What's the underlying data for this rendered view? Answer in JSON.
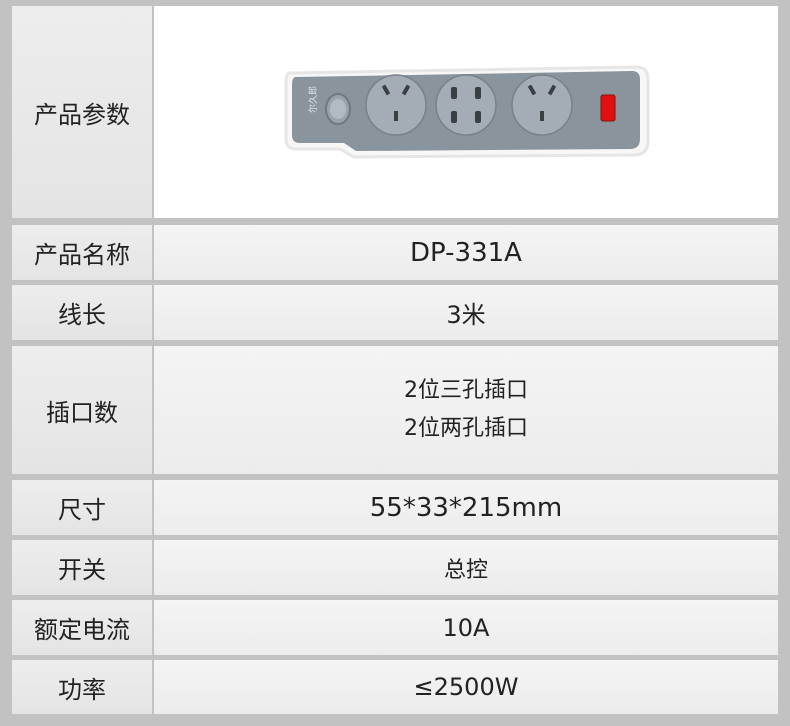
{
  "rows": [
    {
      "label": "产品参数"
    },
    {
      "label": "产品名称",
      "value": "DP-331A"
    },
    {
      "label": "线长",
      "value": "3米"
    },
    {
      "label": "插口数",
      "value_lines": [
        "2位三孔插口",
        "2位两孔插口"
      ]
    },
    {
      "label": "尺寸",
      "value": "55*33*215mm"
    },
    {
      "label": "开关",
      "value": "总控"
    },
    {
      "label": "额定电流",
      "value": "10A"
    },
    {
      "label": "功率",
      "value": "≤2500W"
    }
  ],
  "product_image": {
    "brand_text": "尔久郎",
    "colors": {
      "body": "#8a949d",
      "outlet": "#a4adb6",
      "indicator": "#e01010"
    }
  }
}
